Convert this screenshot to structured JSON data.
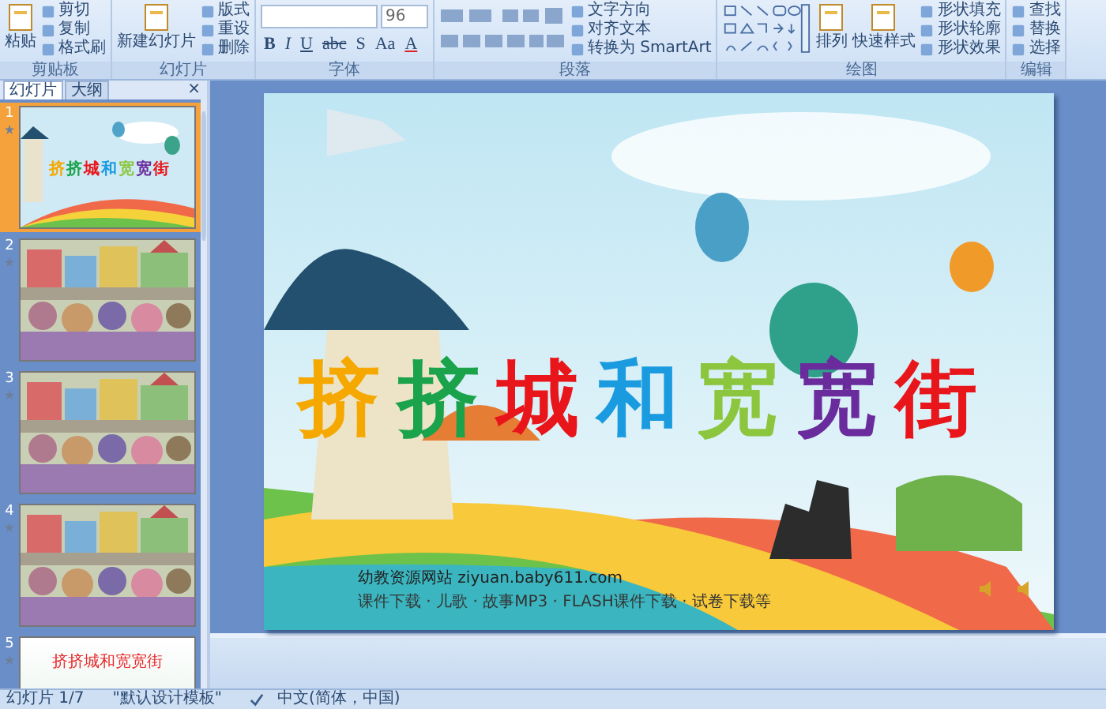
{
  "ribbon": {
    "groups": [
      {
        "label": "剪贴板",
        "items": [
          {
            "kind": "large",
            "text": "粘贴"
          },
          {
            "kind": "small",
            "text": "剪切"
          },
          {
            "kind": "small",
            "text": "复制"
          },
          {
            "kind": "small",
            "text": "格式刷"
          }
        ]
      },
      {
        "label": "幻灯片",
        "items": [
          {
            "kind": "large",
            "text": "新建幻灯片"
          },
          {
            "kind": "small",
            "text": "版式"
          },
          {
            "kind": "small",
            "text": "重设"
          },
          {
            "kind": "small",
            "text": "删除"
          }
        ]
      },
      {
        "label": "字体",
        "items": [
          {
            "kind": "font"
          }
        ],
        "font_size": "96",
        "glyphs": [
          "B",
          "I",
          "U",
          "abc",
          "S",
          "Aa",
          "A"
        ]
      },
      {
        "label": "段落",
        "items": [
          {
            "kind": "para"
          },
          {
            "kind": "small",
            "text": "文字方向"
          },
          {
            "kind": "small",
            "text": "对齐文本"
          },
          {
            "kind": "small",
            "text": "转换为 SmartArt"
          }
        ]
      },
      {
        "label": "绘图",
        "items": [
          {
            "kind": "shapes"
          },
          {
            "kind": "large",
            "text": "排列"
          },
          {
            "kind": "large",
            "text": "快速样式"
          },
          {
            "kind": "small",
            "text": "形状填充"
          },
          {
            "kind": "small",
            "text": "形状轮廓"
          },
          {
            "kind": "small",
            "text": "形状效果"
          }
        ]
      },
      {
        "label": "编辑",
        "items": [
          {
            "kind": "small",
            "text": "查找"
          },
          {
            "kind": "small",
            "text": "替换"
          },
          {
            "kind": "small",
            "text": "选择"
          }
        ]
      }
    ]
  },
  "panel": {
    "tabs": [
      {
        "label": "幻灯片",
        "selected": true
      },
      {
        "label": "大纲",
        "selected": false
      }
    ],
    "close": "×",
    "slides": [
      {
        "number": "1",
        "selected": true,
        "kind": "title",
        "title_chars": [
          {
            "char": "挤",
            "color": "#f5a800"
          },
          {
            "char": "挤",
            "color": "#1aa34a"
          },
          {
            "char": "城",
            "color": "#e8161b"
          },
          {
            "char": "和",
            "color": "#1a9be0"
          },
          {
            "char": "宽",
            "color": "#8cc63e"
          },
          {
            "char": "宽",
            "color": "#6a2c9c"
          },
          {
            "char": "街",
            "color": "#e8161b"
          }
        ]
      },
      {
        "number": "2",
        "selected": false,
        "kind": "picture"
      },
      {
        "number": "3",
        "selected": false,
        "kind": "picture"
      },
      {
        "number": "4",
        "selected": false,
        "kind": "picture"
      },
      {
        "number": "5",
        "selected": false,
        "kind": "text",
        "title": "挤挤城和宽宽街"
      }
    ]
  },
  "slide": {
    "title_chars": [
      {
        "char": "挤",
        "color": "#f5a800"
      },
      {
        "char": "挤",
        "color": "#1aa34a"
      },
      {
        "char": "城",
        "color": "#e8161b"
      },
      {
        "char": "和",
        "color": "#1a9be0"
      },
      {
        "char": "宽",
        "color": "#8cc63e"
      },
      {
        "char": "宽",
        "color": "#6a2c9c"
      },
      {
        "char": "街",
        "color": "#e8161b"
      }
    ],
    "site": "幼教资源网站 ziyuan.baby611.com",
    "tagline": "课件下载 · 儿歌 · 故事MP3 · FLASH课件下载 · 试卷下载等"
  },
  "status_bar": {
    "slide": "幻灯片 1/7",
    "theme": "\"默认设计模板\"",
    "language": "中文(简体，中国)"
  }
}
